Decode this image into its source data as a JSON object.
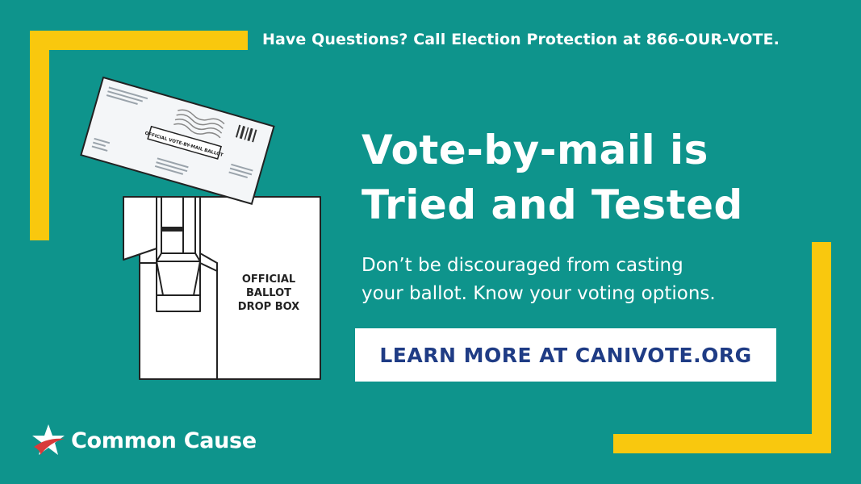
{
  "top_line": "Have Questions? Call Election Protection at 866-OUR-VOTE.",
  "headline": {
    "line1": "Vote-by-mail is",
    "line2": "Tried and Tested"
  },
  "subtext": {
    "line1": "Don’t be discouraged from casting",
    "line2": "your ballot. Know your voting options."
  },
  "cta_label": "LEARN MORE AT CANIVOTE.ORG",
  "envelope_label": "OFFICIAL VOTE-BY-MAIL BALLOT",
  "dropbox_label": {
    "line1": "OFFICIAL",
    "line2": "BALLOT",
    "line3": "DROP BOX"
  },
  "brand_name": "Common Cause",
  "colors": {
    "background": "#0e948c",
    "accent_bars": "#f9c80e",
    "cta_text": "#1f3c85",
    "logo_star": "#ffffff",
    "logo_swoosh": "#d83a3a"
  },
  "icons": [
    "envelope-illustration",
    "ballot-drop-box-illustration",
    "star-logo-icon"
  ]
}
